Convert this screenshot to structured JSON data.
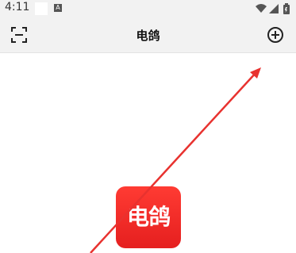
{
  "status_bar": {
    "time": "4:11",
    "notification_icon_label": "A"
  },
  "app_bar": {
    "title": "电鸽"
  },
  "logo": {
    "text": "电鸽"
  },
  "icons": {
    "scan": "scan-icon",
    "add": "add-circle-icon",
    "wifi": "wifi-icon",
    "signal": "signal-icon",
    "battery": "battery-icon"
  },
  "colors": {
    "logo": "#e51f1f",
    "arrow": "#e8322f"
  }
}
